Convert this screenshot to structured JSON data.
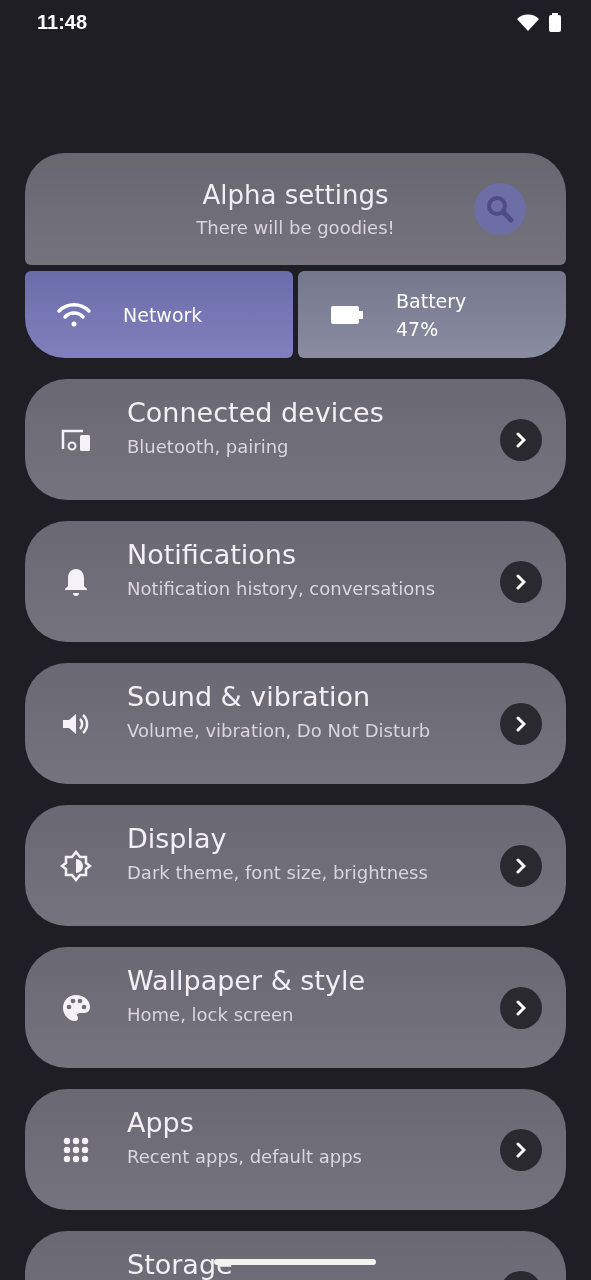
{
  "status_bar": {
    "time": "11:48"
  },
  "header": {
    "title": "Alpha settings",
    "subtitle": "There will be goodies!"
  },
  "tiles": [
    {
      "kind": "network",
      "label": "Network",
      "selected": true
    },
    {
      "kind": "battery",
      "label": "Battery",
      "value": "47%",
      "selected": false
    }
  ],
  "items": [
    {
      "title": "Connected devices",
      "subtitle": "Bluetooth, pairing"
    },
    {
      "title": "Notifications",
      "subtitle": "Notification history, conversations"
    },
    {
      "title": "Sound & vibration",
      "subtitle": "Volume, vibration, Do Not Disturb"
    },
    {
      "title": "Display",
      "subtitle": "Dark theme, font size, brightness"
    },
    {
      "title": "Wallpaper & style",
      "subtitle": "Home, lock screen"
    },
    {
      "title": "Apps",
      "subtitle": "Recent apps, default apps"
    },
    {
      "title": "Storage"
    }
  ]
}
